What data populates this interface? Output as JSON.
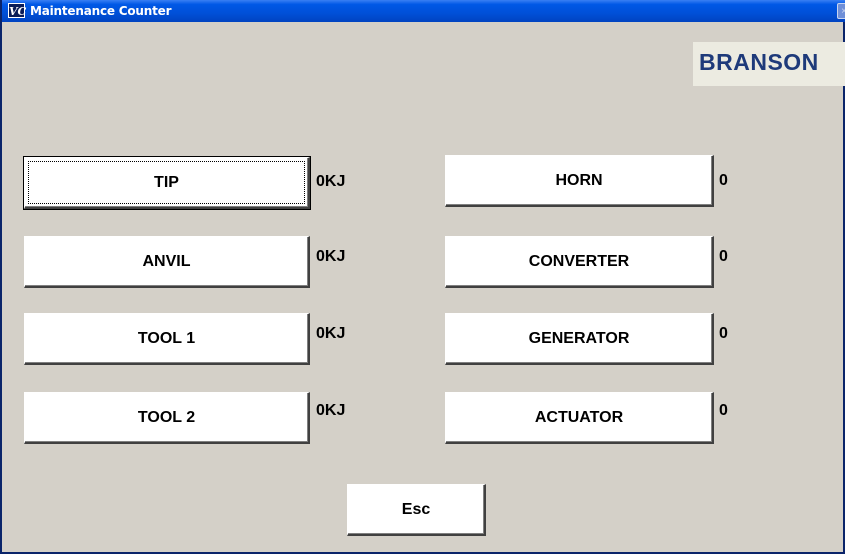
{
  "window": {
    "title": "Maintenance Counter",
    "icon_text": "VC",
    "close_glyph": "×"
  },
  "logo": {
    "text": "BRANSON"
  },
  "left_counters": [
    {
      "label": "TIP",
      "value": "0KJ"
    },
    {
      "label": "ANVIL",
      "value": "0KJ"
    },
    {
      "label": "TOOL 1",
      "value": "0KJ"
    },
    {
      "label": "TOOL 2",
      "value": "0KJ"
    }
  ],
  "right_counters": [
    {
      "label": "HORN",
      "value": "0"
    },
    {
      "label": "CONVERTER",
      "value": "0"
    },
    {
      "label": "GENERATOR",
      "value": "0"
    },
    {
      "label": "ACTUATOR",
      "value": "0"
    }
  ],
  "esc_button": {
    "label": "Esc"
  },
  "colors": {
    "titlebar": "#0058e6",
    "window_bg": "#d4d0c8",
    "logo_text": "#1e3a7a",
    "logo_bg": "#ecebe1"
  }
}
